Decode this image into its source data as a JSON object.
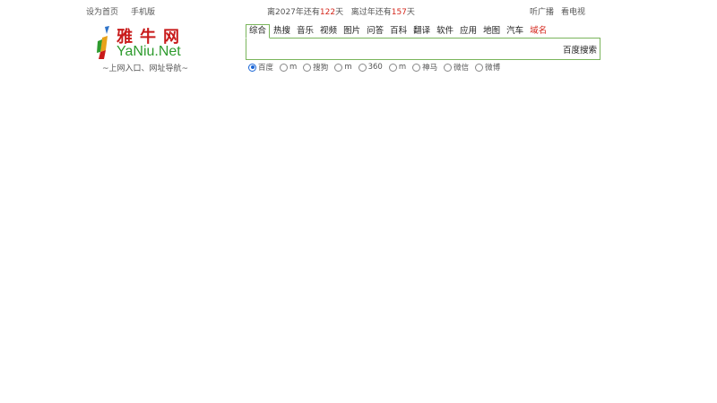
{
  "topbar": {
    "set_home": "设为首页",
    "mobile": "手机版",
    "countdown_prefix1": "离2027年还有",
    "days_to_2027": "122",
    "countdown_suffix1": "天",
    "countdown_prefix2": "离过年还有",
    "days_to_new_year": "157",
    "countdown_suffix2": "天",
    "radio": "听广播",
    "tv": "看电视"
  },
  "logo": {
    "cn": "雅牛网",
    "en": "YaNiu.Net",
    "tagline": "~上网入口、网址导航~"
  },
  "search": {
    "tabs": [
      {
        "label": "综合"
      },
      {
        "label": "热搜"
      },
      {
        "label": "音乐"
      },
      {
        "label": "视频"
      },
      {
        "label": "图片"
      },
      {
        "label": "问答"
      },
      {
        "label": "百科"
      },
      {
        "label": "翻译"
      },
      {
        "label": "软件"
      },
      {
        "label": "应用"
      },
      {
        "label": "地图"
      },
      {
        "label": "汽车"
      },
      {
        "label": "域名"
      }
    ],
    "active_tab": "综合",
    "highlight_color": "#d4271c",
    "input_value": "",
    "button_label": "百度搜索",
    "engines": [
      {
        "label": "百度",
        "checked": true
      },
      {
        "label": "m",
        "checked": false
      },
      {
        "label": "搜狗",
        "checked": false
      },
      {
        "label": "m",
        "checked": false
      },
      {
        "label": "360",
        "checked": false
      },
      {
        "label": "m",
        "checked": false
      },
      {
        "label": "神马",
        "checked": false
      },
      {
        "label": "微信",
        "checked": false
      },
      {
        "label": "微博",
        "checked": false
      }
    ]
  },
  "colors": {
    "border_green": "#7ab55c",
    "accent_red": "#d4271c",
    "radio_blue": "#1a66d6"
  }
}
